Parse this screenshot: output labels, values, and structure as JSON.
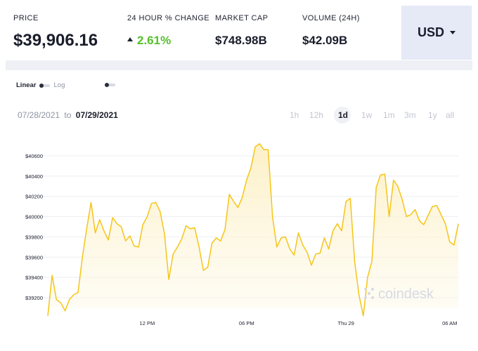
{
  "stats": {
    "price": {
      "label": "PRICE",
      "value": "$39,906.16"
    },
    "change": {
      "label": "24 HOUR % CHANGE",
      "value": "2.61%"
    },
    "market_cap": {
      "label": "MARKET CAP",
      "value": "$748.98B"
    },
    "volume": {
      "label": "VOLUME (24H)",
      "value": "$42.09B"
    }
  },
  "currency": {
    "selected": "USD"
  },
  "scale": {
    "linear": "Linear",
    "log": "Log",
    "active": "Linear"
  },
  "date_range": {
    "from": "07/28/2021",
    "to_word": "to",
    "to": "07/29/2021"
  },
  "ranges": [
    "1h",
    "12h",
    "1d",
    "1w",
    "1m",
    "3m",
    "1y",
    "all"
  ],
  "active_range": "1d",
  "watermark": "coindesk",
  "colors": {
    "line": "#f5c518",
    "fill": "#fdf3cf",
    "up": "#55c12b",
    "currency_bg": "#e6e9f6"
  },
  "chart_data": {
    "type": "area",
    "title": "",
    "xlabel": "",
    "ylabel": "",
    "grid": true,
    "ylim": [
      39100,
      40700
    ],
    "yticks": [
      39200,
      39400,
      39600,
      39800,
      40000,
      40200,
      40400,
      40600
    ],
    "ytick_labels": [
      "$39200",
      "$39400",
      "$39600",
      "$39800",
      "$40000",
      "$40200",
      "$40400",
      "$40600"
    ],
    "xticks": [
      {
        "i": 23,
        "label": "12 PM"
      },
      {
        "i": 46,
        "label": "06 PM"
      },
      {
        "i": 69,
        "label": "Thu 29"
      },
      {
        "i": 93,
        "label": "06 AM"
      }
    ],
    "series": [
      {
        "values": [
          39020,
          39420,
          39180,
          39150,
          39070,
          39180,
          39230,
          39250,
          39600,
          39880,
          40140,
          39840,
          39970,
          39860,
          39770,
          39990,
          39930,
          39900,
          39760,
          39810,
          39710,
          39700,
          39920,
          40000,
          40130,
          40140,
          40050,
          39830,
          39380,
          39630,
          39700,
          39780,
          39910,
          39880,
          39890,
          39700,
          39470,
          39500,
          39740,
          39790,
          39760,
          39870,
          40220,
          40150,
          40090,
          40190,
          40360,
          40480,
          40690,
          40720,
          40660,
          40660,
          40000,
          39700,
          39790,
          39800,
          39680,
          39620,
          39840,
          39720,
          39650,
          39520,
          39630,
          39640,
          39790,
          39680,
          39860,
          39930,
          39860,
          40150,
          40180,
          39560,
          39230,
          39020,
          39400,
          39560,
          40290,
          40410,
          40420,
          40000,
          40360,
          40300,
          40170,
          40000,
          40020,
          40070,
          39960,
          39920,
          40010,
          40100,
          40110,
          40020,
          39930,
          39750,
          39720,
          39930
        ]
      }
    ]
  }
}
